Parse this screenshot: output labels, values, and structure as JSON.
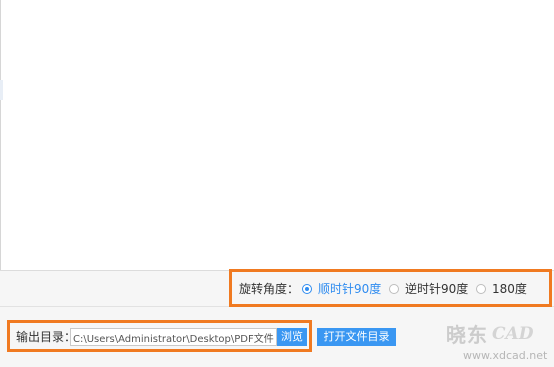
{
  "rotation": {
    "label": "旋转角度：",
    "options": [
      {
        "label": "顺时针90度",
        "selected": true
      },
      {
        "label": "逆时针90度",
        "selected": false
      },
      {
        "label": "180度",
        "selected": false
      }
    ]
  },
  "output": {
    "label": "输出目录：",
    "path": "C:\\Users\\Administrator\\Desktop\\PDF文件",
    "browse_label": "浏览",
    "open_folder_label": "打开文件目录"
  },
  "watermark": {
    "brand_cn": "晓东",
    "brand_cad": "CAD",
    "url": "www.xdcad.net"
  },
  "colors": {
    "accent": "#2f8cf0",
    "button": "#3a97f2",
    "highlight": "#f07a21",
    "panel_bg": "#f6f6f6"
  }
}
